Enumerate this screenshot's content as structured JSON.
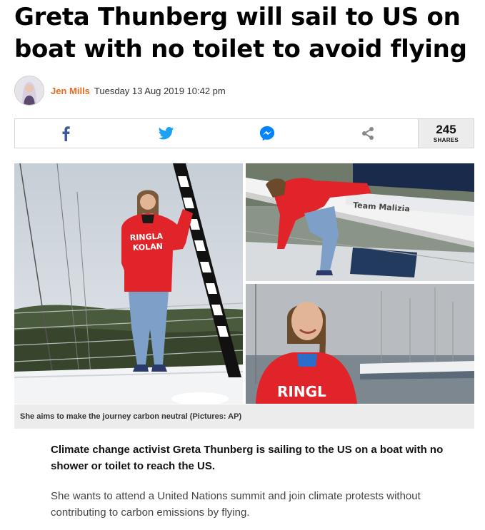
{
  "article": {
    "headline": "Greta Thunberg will sail to US on boat with no toilet to avoid flying",
    "author": "Jen Mills",
    "date": "Tuesday 13 Aug 2019 10:42 pm",
    "lead": "Climate change activist Greta Thunberg is sailing to the US on a boat with no shower or toilet to reach the US.",
    "body": "She wants to attend a United Nations summit and join climate protests without contributing to carbon emissions by flying."
  },
  "share": {
    "count": "245",
    "count_label": "SHARES",
    "icons": [
      "facebook-icon",
      "twitter-icon",
      "messenger-icon",
      "share-icon"
    ],
    "colors": {
      "facebook": "#3b5998",
      "twitter": "#1da1f2",
      "messenger": "#0084ff",
      "share": "#888888"
    }
  },
  "photos": {
    "caption": "She aims to make the journey carbon neutral (Pictures: AP)",
    "hoodie_text": [
      "RINGLA",
      "KOLAN"
    ],
    "boat_text": "Team Malizia"
  },
  "colors": {
    "author": "#e86b1f",
    "hoodie": "#e0242a"
  }
}
